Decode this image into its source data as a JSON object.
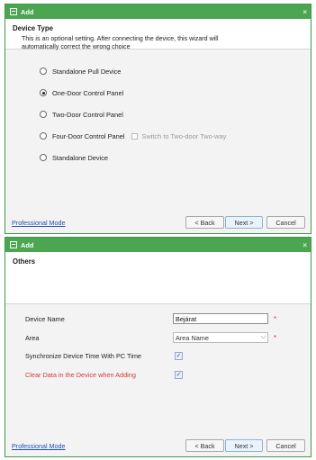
{
  "dialog1": {
    "title": "Add",
    "close_glyph": "×",
    "header_title": "Device Type",
    "header_desc": "This is an optional setting. After connecting the device, this wizard will automatically correct the wrong choice",
    "options": [
      {
        "label": "Standalone Pull Device",
        "selected": false
      },
      {
        "label": "One-Door Control Panel",
        "selected": true
      },
      {
        "label": "Two-Door Control Panel",
        "selected": false
      },
      {
        "label": "Four-Door Control Panel",
        "selected": false,
        "extra_checkbox_label": "Switch to Two-door Two-way"
      },
      {
        "label": "Standalone Device",
        "selected": false
      }
    ],
    "footer": {
      "pro_mode": "Professional Mode",
      "back": "< Back",
      "next": "Next >",
      "cancel": "Cancel"
    }
  },
  "dialog2": {
    "title": "Add",
    "close_glyph": "×",
    "header_title": "Others",
    "fields": {
      "device_name_label": "Device Name",
      "device_name_value": "Bejárat",
      "area_label": "Area",
      "area_value": "Area Name",
      "sync_label": "Synchronize Device Time With PC Time",
      "sync_checked": true,
      "clear_label": "Clear Data in the Device when Adding",
      "clear_checked": true,
      "required_mark": "*",
      "check_glyph": "✓",
      "chevron": "⌵"
    },
    "footer": {
      "pro_mode": "Professional Mode",
      "back": "< Back",
      "next": "Next >",
      "cancel": "Cancel"
    }
  },
  "icons": {
    "app": "window-icon",
    "close": "close-icon"
  },
  "colors": {
    "titlebar": "#4ba551",
    "link": "#1f4fb8",
    "required": "#d13838"
  }
}
